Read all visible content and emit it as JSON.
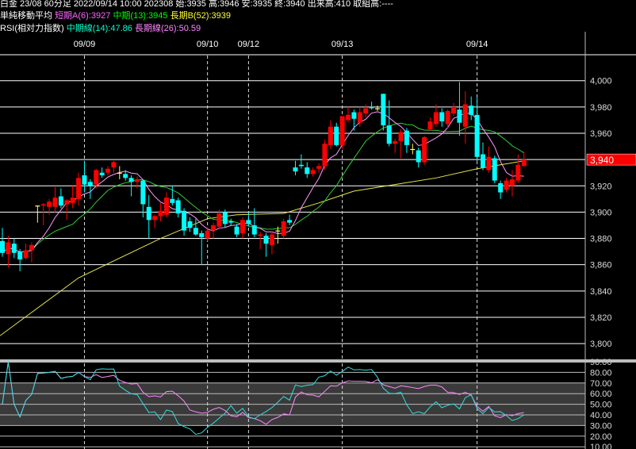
{
  "header": {
    "line1": "白金 23/08 60分足 2022/09/14 10:00 202308 始:3935 高:3946 安:3935 終:3940 出来高:410 取組高:----",
    "ma_title": "単純移動平均",
    "ma_short": "短期A(6):3927",
    "ma_mid": "中期(13):3945",
    "ma_long": "長期B(52):3939",
    "rsi_title": "RSI(相対力指数)",
    "rsi_mid": "中期線(14):47.86",
    "rsi_long": "長期線(26):50.59"
  },
  "colors": {
    "up": "#ff0000",
    "down": "#00ffff",
    "doji": "#ffff66",
    "ma6": "#ff99ff",
    "ma13": "#33cc33",
    "ma52": "#e6e64d",
    "rsi14": "#33dddd",
    "rsi26": "#ff88ff",
    "grid": "#ffffff",
    "rsi_band": "#3a3a3a"
  },
  "chart_data": {
    "type": "candlestick",
    "title": "白金 23/08 60分足",
    "current_price_label": "3,940",
    "current_price": 3940,
    "ylim": [
      3787,
      4019
    ],
    "y_ticks": [
      4000,
      3980,
      3960,
      3940,
      3920,
      3900,
      3880,
      3860,
      3840,
      3820,
      3800
    ],
    "y_tick_labels": [
      "4,000",
      "3,980",
      "3,960",
      "3,940",
      "3,920",
      "3,900",
      "3,880",
      "3,860",
      "3,840",
      "3,820",
      "3,800"
    ],
    "date_markers": [
      {
        "label": "09/09",
        "index": 14
      },
      {
        "label": "09/10",
        "index": 35
      },
      {
        "label": "09/12",
        "index": 42
      },
      {
        "label": "09/13",
        "index": 58
      },
      {
        "label": "09/14",
        "index": 81
      }
    ],
    "ohlc": [
      [
        3878,
        3888,
        3866,
        3869
      ],
      [
        3868,
        3882,
        3858,
        3877
      ],
      [
        3876,
        3880,
        3865,
        3869
      ],
      [
        3870,
        3872,
        3855,
        3864
      ],
      [
        3865,
        3876,
        3864,
        3871
      ],
      [
        3871,
        3877,
        3862,
        3875
      ],
      [
        3905,
        3905,
        3892,
        3905
      ],
      [
        3905,
        3907,
        3890,
        3906
      ],
      [
        3904,
        3910,
        3898,
        3908
      ],
      [
        3904,
        3919,
        3900,
        3911
      ],
      [
        3912,
        3918,
        3903,
        3905
      ],
      [
        3906,
        3910,
        3894,
        3909
      ],
      [
        3907,
        3920,
        3903,
        3911
      ],
      [
        3910,
        3930,
        3905,
        3926
      ],
      [
        3928,
        3939,
        3915,
        3921
      ],
      [
        3923,
        3925,
        3910,
        3920
      ],
      [
        3921,
        3933,
        3918,
        3932
      ],
      [
        3930,
        3934,
        3926,
        3928
      ],
      [
        3930,
        3935,
        3928,
        3933
      ],
      [
        3934,
        3939,
        3930,
        3938
      ],
      [
        3930,
        3935,
        3925,
        3930
      ],
      [
        3929,
        3932,
        3924,
        3926
      ],
      [
        3926,
        3928,
        3912,
        3923
      ],
      [
        3923,
        3927,
        3918,
        3925
      ],
      [
        3924,
        3925,
        3896,
        3906
      ],
      [
        3904,
        3913,
        3880,
        3894
      ],
      [
        3894,
        3898,
        3888,
        3897
      ],
      [
        3897,
        3907,
        3893,
        3901
      ],
      [
        3898,
        3915,
        3896,
        3911
      ],
      [
        3910,
        3920,
        3905,
        3907
      ],
      [
        3909,
        3911,
        3896,
        3899
      ],
      [
        3901,
        3903,
        3882,
        3886
      ],
      [
        3893,
        3896,
        3885,
        3888
      ],
      [
        3888,
        3895,
        3882,
        3883
      ],
      [
        3884,
        3886,
        3860,
        3881
      ],
      [
        3880,
        3888,
        3878,
        3886
      ],
      [
        3886,
        3892,
        3880,
        3890
      ],
      [
        3889,
        3902,
        3887,
        3899
      ],
      [
        3900,
        3902,
        3888,
        3891
      ],
      [
        3893,
        3895,
        3890,
        3892
      ],
      [
        3889,
        3891,
        3881,
        3883
      ],
      [
        3884,
        3896,
        3880,
        3894
      ],
      [
        3894,
        3900,
        3889,
        3891
      ],
      [
        3890,
        3903,
        3881,
        3883
      ],
      [
        3882,
        3885,
        3872,
        3883
      ],
      [
        3882,
        3884,
        3866,
        3876
      ],
      [
        3875,
        3885,
        3868,
        3883
      ],
      [
        3886,
        3889,
        3876,
        3886
      ],
      [
        3882,
        3895,
        3880,
        3893
      ],
      [
        3894,
        3898,
        3890,
        3892
      ],
      [
        3934,
        3939,
        3928,
        3931
      ],
      [
        3936,
        3944,
        3933,
        3935
      ],
      [
        3934,
        3938,
        3926,
        3929
      ],
      [
        3929,
        3934,
        3927,
        3932
      ],
      [
        3933,
        3937,
        3930,
        3935
      ],
      [
        3935,
        3955,
        3932,
        3952
      ],
      [
        3951,
        3970,
        3948,
        3965
      ],
      [
        3965,
        3968,
        3950,
        3951
      ],
      [
        3951,
        3973,
        3948,
        3973
      ],
      [
        3970,
        3980,
        3968,
        3974
      ],
      [
        3976,
        3978,
        3962,
        3971
      ],
      [
        3968,
        3980,
        3965,
        3976
      ],
      [
        3975,
        3982,
        3972,
        3979
      ],
      [
        3980,
        3984,
        3978,
        3979
      ],
      [
        3979,
        3981,
        3977,
        3979
      ],
      [
        3990,
        3990,
        3962,
        3966
      ],
      [
        3966,
        3985,
        3950,
        3952
      ],
      [
        3952,
        3956,
        3945,
        3954
      ],
      [
        3954,
        3963,
        3941,
        3961
      ],
      [
        3962,
        3964,
        3945,
        3951
      ],
      [
        3948,
        3952,
        3944,
        3948
      ],
      [
        3947,
        3949,
        3934,
        3938
      ],
      [
        3938,
        3958,
        3936,
        3957
      ],
      [
        3963,
        3972,
        3962,
        3969
      ],
      [
        3967,
        3982,
        3965,
        3976
      ],
      [
        3976,
        3979,
        3965,
        3969
      ],
      [
        3967,
        3978,
        3964,
        3977
      ],
      [
        3975,
        3983,
        3973,
        3980
      ],
      [
        3978,
        3999,
        3958,
        3968
      ],
      [
        3965,
        3992,
        3952,
        3982
      ],
      [
        3981,
        3988,
        3970,
        3974
      ],
      [
        3974,
        3987,
        3938,
        3942
      ],
      [
        3944,
        3953,
        3932,
        3934
      ],
      [
        3932,
        3950,
        3930,
        3942
      ],
      [
        3941,
        3943,
        3922,
        3924
      ],
      [
        3922,
        3924,
        3910,
        3915
      ],
      [
        3917,
        3926,
        3915,
        3924
      ],
      [
        3920,
        3932,
        3912,
        3925
      ],
      [
        3924,
        3944,
        3922,
        3936
      ],
      [
        3935,
        3946,
        3935,
        3940
      ]
    ],
    "ma52_keypoints": [
      [
        -0.4,
        3806
      ],
      [
        13,
        3850
      ],
      [
        27,
        3880
      ],
      [
        35,
        3895
      ],
      [
        40,
        3898
      ],
      [
        48,
        3899
      ],
      [
        54,
        3907
      ],
      [
        60,
        3916
      ],
      [
        67,
        3921
      ],
      [
        74,
        3926
      ],
      [
        81,
        3933
      ],
      [
        89,
        3939
      ]
    ],
    "rsi": {
      "ylim": [
        10,
        90
      ],
      "band": [
        30,
        70
      ],
      "y_ticks": [
        90,
        80,
        70,
        60,
        50,
        40,
        30,
        20,
        10
      ],
      "y_tick_labels": [
        "90.00",
        "80.00",
        "70.00",
        "60.00",
        "50.00",
        "40.00",
        "30.00",
        "20.00",
        "10.00"
      ],
      "periods": [
        14,
        26
      ]
    }
  }
}
